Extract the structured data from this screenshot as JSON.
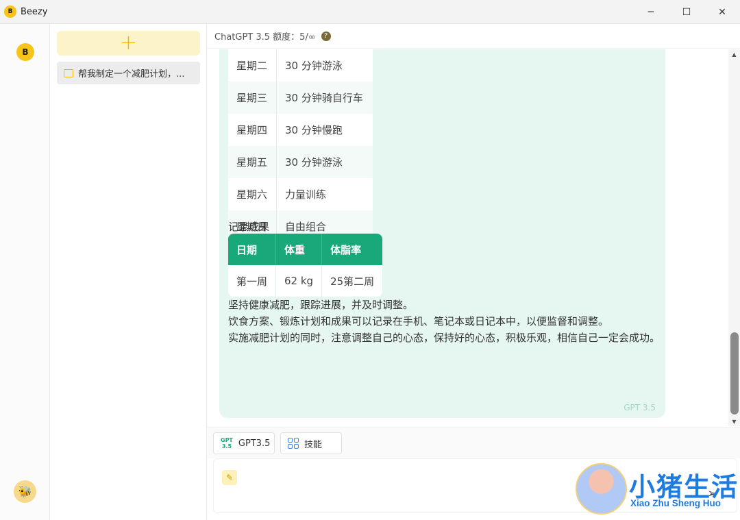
{
  "window": {
    "title": "Beezy",
    "logo_text": "B",
    "controls": {
      "minimize": "─",
      "maximize": "☐",
      "close": "✕"
    }
  },
  "rail": {
    "logo_text": "B",
    "bottom_icon": "bee-icon"
  },
  "sidebar": {
    "new_chat_label": "+",
    "items": [
      {
        "label": "帮我制定一个减肥计划，..."
      }
    ]
  },
  "header": {
    "quota_text": "ChatGPT 3.5 额度：5/∞",
    "help_icon": "?"
  },
  "message": {
    "exercise_table": [
      {
        "day": "星期二",
        "activity": "30 分钟游泳"
      },
      {
        "day": "星期三",
        "activity": "30 分钟骑自行车"
      },
      {
        "day": "星期四",
        "activity": "30 分钟慢跑"
      },
      {
        "day": "星期五",
        "activity": "30 分钟游泳"
      },
      {
        "day": "星期六",
        "activity": "力量训练"
      },
      {
        "day": "星期日",
        "activity": "自由组合"
      }
    ],
    "record_heading": "记录成果",
    "record_table": {
      "headers": [
        "日期",
        "体重",
        "体脂率"
      ],
      "rows": [
        [
          "第一周",
          "62 kg",
          "25第二周"
        ]
      ]
    },
    "paragraphs": [
      "坚持健康减肥，跟踪进展，并及时调整。",
      "饮食方案、锻炼计划和成果可以记录在手机、笔记本或日记本中，以便监督和调整。",
      "实施减肥计划的同时，注意调整自己的心态，保持好的心态，积极乐观，相信自己一定会成功。"
    ],
    "model_tag": "GPT 3.5"
  },
  "toolbar": {
    "gpt_badge_top": "GPT",
    "gpt_badge_bottom": "3.5",
    "gpt_label": "GPT3.5",
    "skill_label": "技能"
  },
  "input": {
    "wand_icon": "✎",
    "send_icon": "➢"
  },
  "watermark": {
    "title": "小猪生活",
    "subtitle": "Xiao Zhu Sheng Huo"
  },
  "colors": {
    "accent": "#f7c41a",
    "table_header": "#18a87a",
    "bubble": "#e6f6f1",
    "watermark": "#1e7be0"
  }
}
